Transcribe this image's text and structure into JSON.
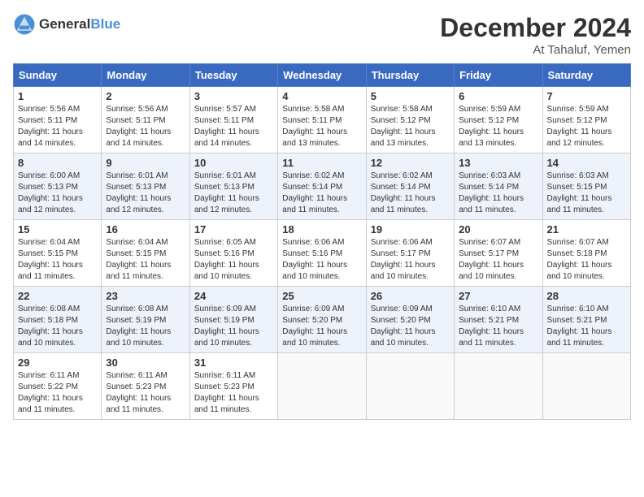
{
  "header": {
    "logo_general": "General",
    "logo_blue": "Blue",
    "month": "December 2024",
    "location": "At Tahaluf, Yemen"
  },
  "weekdays": [
    "Sunday",
    "Monday",
    "Tuesday",
    "Wednesday",
    "Thursday",
    "Friday",
    "Saturday"
  ],
  "weeks": [
    [
      {
        "day": 1,
        "info": "Sunrise: 5:56 AM\nSunset: 5:11 PM\nDaylight: 11 hours\nand 14 minutes."
      },
      {
        "day": 2,
        "info": "Sunrise: 5:56 AM\nSunset: 5:11 PM\nDaylight: 11 hours\nand 14 minutes."
      },
      {
        "day": 3,
        "info": "Sunrise: 5:57 AM\nSunset: 5:11 PM\nDaylight: 11 hours\nand 14 minutes."
      },
      {
        "day": 4,
        "info": "Sunrise: 5:58 AM\nSunset: 5:11 PM\nDaylight: 11 hours\nand 13 minutes."
      },
      {
        "day": 5,
        "info": "Sunrise: 5:58 AM\nSunset: 5:12 PM\nDaylight: 11 hours\nand 13 minutes."
      },
      {
        "day": 6,
        "info": "Sunrise: 5:59 AM\nSunset: 5:12 PM\nDaylight: 11 hours\nand 13 minutes."
      },
      {
        "day": 7,
        "info": "Sunrise: 5:59 AM\nSunset: 5:12 PM\nDaylight: 11 hours\nand 12 minutes."
      }
    ],
    [
      {
        "day": 8,
        "info": "Sunrise: 6:00 AM\nSunset: 5:13 PM\nDaylight: 11 hours\nand 12 minutes."
      },
      {
        "day": 9,
        "info": "Sunrise: 6:01 AM\nSunset: 5:13 PM\nDaylight: 11 hours\nand 12 minutes."
      },
      {
        "day": 10,
        "info": "Sunrise: 6:01 AM\nSunset: 5:13 PM\nDaylight: 11 hours\nand 12 minutes."
      },
      {
        "day": 11,
        "info": "Sunrise: 6:02 AM\nSunset: 5:14 PM\nDaylight: 11 hours\nand 11 minutes."
      },
      {
        "day": 12,
        "info": "Sunrise: 6:02 AM\nSunset: 5:14 PM\nDaylight: 11 hours\nand 11 minutes."
      },
      {
        "day": 13,
        "info": "Sunrise: 6:03 AM\nSunset: 5:14 PM\nDaylight: 11 hours\nand 11 minutes."
      },
      {
        "day": 14,
        "info": "Sunrise: 6:03 AM\nSunset: 5:15 PM\nDaylight: 11 hours\nand 11 minutes."
      }
    ],
    [
      {
        "day": 15,
        "info": "Sunrise: 6:04 AM\nSunset: 5:15 PM\nDaylight: 11 hours\nand 11 minutes."
      },
      {
        "day": 16,
        "info": "Sunrise: 6:04 AM\nSunset: 5:15 PM\nDaylight: 11 hours\nand 11 minutes."
      },
      {
        "day": 17,
        "info": "Sunrise: 6:05 AM\nSunset: 5:16 PM\nDaylight: 11 hours\nand 10 minutes."
      },
      {
        "day": 18,
        "info": "Sunrise: 6:06 AM\nSunset: 5:16 PM\nDaylight: 11 hours\nand 10 minutes."
      },
      {
        "day": 19,
        "info": "Sunrise: 6:06 AM\nSunset: 5:17 PM\nDaylight: 11 hours\nand 10 minutes."
      },
      {
        "day": 20,
        "info": "Sunrise: 6:07 AM\nSunset: 5:17 PM\nDaylight: 11 hours\nand 10 minutes."
      },
      {
        "day": 21,
        "info": "Sunrise: 6:07 AM\nSunset: 5:18 PM\nDaylight: 11 hours\nand 10 minutes."
      }
    ],
    [
      {
        "day": 22,
        "info": "Sunrise: 6:08 AM\nSunset: 5:18 PM\nDaylight: 11 hours\nand 10 minutes."
      },
      {
        "day": 23,
        "info": "Sunrise: 6:08 AM\nSunset: 5:19 PM\nDaylight: 11 hours\nand 10 minutes."
      },
      {
        "day": 24,
        "info": "Sunrise: 6:09 AM\nSunset: 5:19 PM\nDaylight: 11 hours\nand 10 minutes."
      },
      {
        "day": 25,
        "info": "Sunrise: 6:09 AM\nSunset: 5:20 PM\nDaylight: 11 hours\nand 10 minutes."
      },
      {
        "day": 26,
        "info": "Sunrise: 6:09 AM\nSunset: 5:20 PM\nDaylight: 11 hours\nand 10 minutes."
      },
      {
        "day": 27,
        "info": "Sunrise: 6:10 AM\nSunset: 5:21 PM\nDaylight: 11 hours\nand 11 minutes."
      },
      {
        "day": 28,
        "info": "Sunrise: 6:10 AM\nSunset: 5:21 PM\nDaylight: 11 hours\nand 11 minutes."
      }
    ],
    [
      {
        "day": 29,
        "info": "Sunrise: 6:11 AM\nSunset: 5:22 PM\nDaylight: 11 hours\nand 11 minutes."
      },
      {
        "day": 30,
        "info": "Sunrise: 6:11 AM\nSunset: 5:23 PM\nDaylight: 11 hours\nand 11 minutes."
      },
      {
        "day": 31,
        "info": "Sunrise: 6:11 AM\nSunset: 5:23 PM\nDaylight: 11 hours\nand 11 minutes."
      },
      null,
      null,
      null,
      null
    ]
  ]
}
